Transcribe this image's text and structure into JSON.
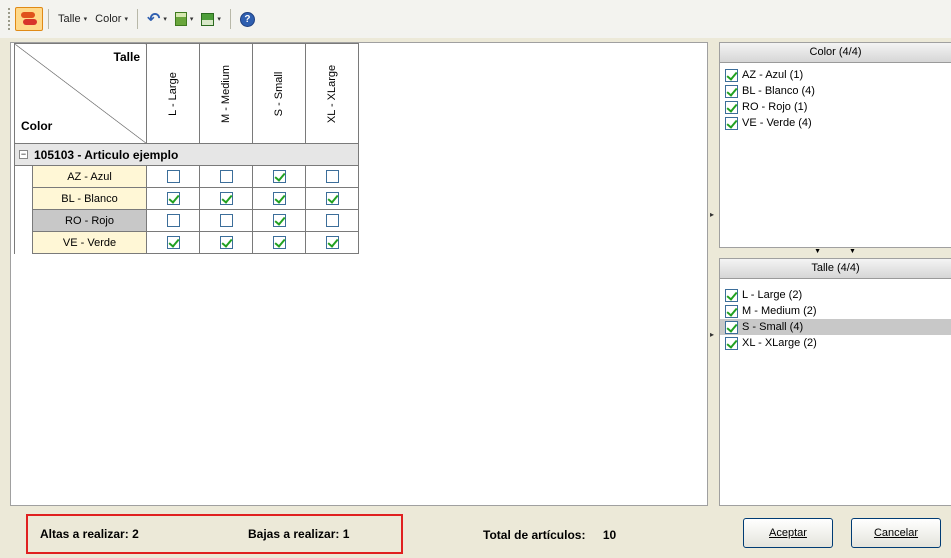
{
  "toolbar": {
    "talle_label": "Talle",
    "color_label": "Color",
    "caret": "▾"
  },
  "grid": {
    "corner_top": "Talle",
    "corner_bottom": "Color",
    "columns": [
      "L - Large",
      "M - Medium",
      "S - Small",
      "XL - XLarge"
    ],
    "group_label": "105103 - Articulo ejemplo",
    "rows": [
      {
        "label": "AZ - Azul",
        "checks": [
          false,
          false,
          true,
          false
        ],
        "selected": false
      },
      {
        "label": "BL - Blanco",
        "checks": [
          true,
          true,
          true,
          true
        ],
        "selected": false
      },
      {
        "label": "RO - Rojo",
        "checks": [
          false,
          false,
          true,
          false
        ],
        "selected": true
      },
      {
        "label": "VE - Verde",
        "checks": [
          true,
          true,
          true,
          true
        ],
        "selected": false
      }
    ]
  },
  "color_panel": {
    "title": "Color (4/4)",
    "items": [
      {
        "label": "AZ - Azul (1)",
        "checked": true
      },
      {
        "label": "BL - Blanco (4)",
        "checked": true
      },
      {
        "label": "RO - Rojo (1)",
        "checked": true
      },
      {
        "label": "VE - Verde (4)",
        "checked": true
      }
    ]
  },
  "talle_panel": {
    "title": "Talle (4/4)",
    "items": [
      {
        "label": "L - Large (2)",
        "checked": true,
        "selected": false
      },
      {
        "label": "M - Medium (2)",
        "checked": true,
        "selected": false
      },
      {
        "label": "S - Small (4)",
        "checked": true,
        "selected": true
      },
      {
        "label": "XL - XLarge (2)",
        "checked": true,
        "selected": false
      }
    ]
  },
  "status": {
    "altas_label": "Altas a realizar:",
    "altas_value": "2",
    "bajas_label": "Bajas a realizar:",
    "bajas_value": "1",
    "total_label": "Total de artículos:",
    "total_value": "10"
  },
  "buttons": {
    "aceptar": "Aceptar",
    "cancelar": "Cancelar"
  },
  "colors": {
    "row_header_bg": "#fff7d6",
    "selected_bg": "#c8c8c8",
    "highlight_border": "#e02020",
    "check_color": "#21a121"
  }
}
